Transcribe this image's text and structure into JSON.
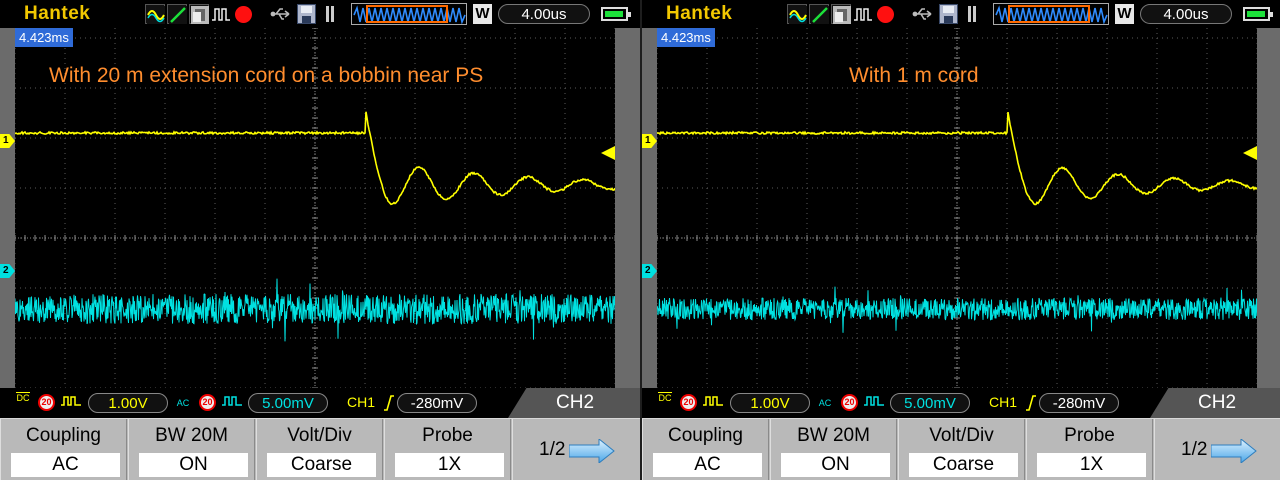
{
  "panels": [
    {
      "id": "left",
      "brand": "Hantek",
      "timebase": "4.00us",
      "trigger_position": "4.423ms",
      "annotation": "With 20 m extension cord on a bobbin near PS",
      "ch1_marker": "1",
      "ch2_marker": "2",
      "ch1_coupling_badge": "DC",
      "ch1_bw_badge": "20",
      "ch1_scale": "1.00V",
      "ch2_coupling_badge": "AC",
      "ch2_bw_badge": "20",
      "ch2_scale": "5.00mV",
      "trigger_source": "CH1",
      "trigger_level": "-280mV",
      "active_channel": "CH2",
      "softkeys": [
        {
          "title": "Coupling",
          "value": "AC"
        },
        {
          "title": "BW 20M",
          "value": "ON"
        },
        {
          "title": "Volt/Div",
          "value": "Coarse"
        },
        {
          "title": "Probe",
          "value": "1X"
        }
      ],
      "page": "1/2",
      "ringing": {
        "amplitude": 1.0,
        "decay": 0.28,
        "period_div": 0.88
      }
    },
    {
      "id": "right",
      "brand": "Hantek",
      "timebase": "4.00us",
      "trigger_position": "4.423ms",
      "annotation": "With 1 m cord",
      "ch1_marker": "1",
      "ch2_marker": "2",
      "ch1_coupling_badge": "DC",
      "ch1_bw_badge": "20",
      "ch1_scale": "1.00V",
      "ch2_coupling_badge": "AC",
      "ch2_bw_badge": "20",
      "ch2_scale": "5.00mV",
      "trigger_source": "CH1",
      "trigger_level": "-280mV",
      "active_channel": "CH2",
      "softkeys": [
        {
          "title": "Coupling",
          "value": "AC"
        },
        {
          "title": "BW 20M",
          "value": "ON"
        },
        {
          "title": "Volt/Div",
          "value": "Coarse"
        },
        {
          "title": "Probe",
          "value": "1X"
        }
      ],
      "page": "1/2",
      "ringing": {
        "amplitude": 1.0,
        "decay": 0.32,
        "period_div": 0.9
      }
    }
  ],
  "colors": {
    "ch1": "#ffff00",
    "ch2": "#00e1e1",
    "brand": "#f2c800",
    "annotation": "#ff8d2e",
    "trigger_marker": "#2f6bd8"
  },
  "icons": [
    "sine-mode-icon",
    "ramp-mode-icon",
    "persistence-icon",
    "pulse-mode-icon",
    "run-stop-icon",
    "usb-icon",
    "save-icon",
    "timeline-icon",
    "battery-icon",
    "rising-edge-icon",
    "next-page-arrow-icon"
  ]
}
